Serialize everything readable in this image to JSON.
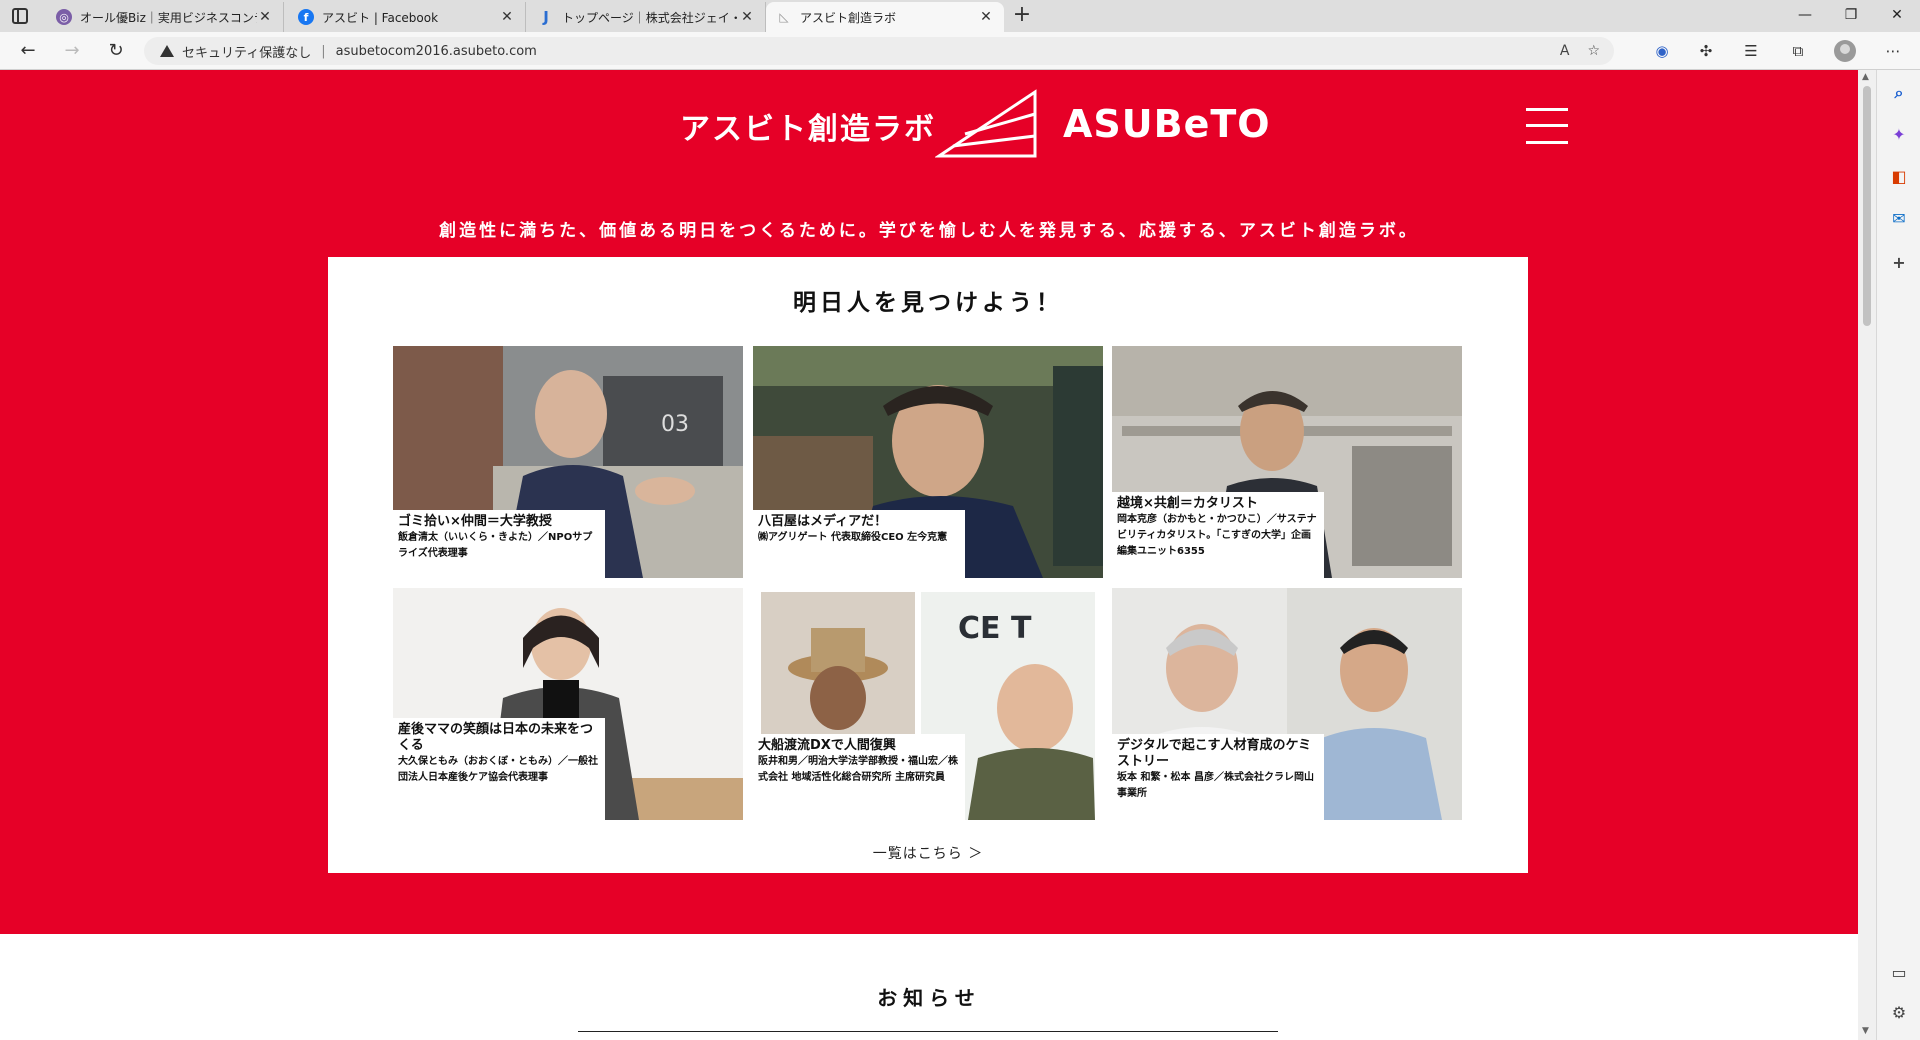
{
  "browser": {
    "tabs": [
      {
        "label": "オール優Biz｜実用ビジネスコンテンツ",
        "favicon": "purple-circle-icon",
        "color": "#7b5ea7"
      },
      {
        "label": "アスビト | Facebook",
        "favicon": "facebook-icon",
        "color": "#1877f2"
      },
      {
        "label": "トップページ｜株式会社ジェイ・キャス",
        "favicon": "j-letter-icon",
        "color": "#2a6dd1"
      },
      {
        "label": "アスビト創造ラボ",
        "favicon": "asubeto-icon",
        "color": "#999999"
      }
    ],
    "security_label": "セキュリティ保護なし",
    "url": "asubetocom2016.asubeto.com"
  },
  "site": {
    "logo_jp": "アスビト創造ラボ",
    "logo_en": "ASUBeTO",
    "tagline": "創造性に満ちた、価値ある明日をつくるために。学びを愉しむ人を発見する、応援する、アスビト創造ラボ。",
    "brand_color": "#e60027"
  },
  "featured": {
    "title": "明日人を見つけよう！",
    "more_link": "一覧はこちら ＞",
    "items": [
      {
        "title": "ゴミ拾い×仲間＝大学教授",
        "sub": "飯倉清太（いいくら・きよた）／NPOサプライズ代表理事"
      },
      {
        "title": "八百屋はメディアだ！",
        "sub": "㈱アグリゲート 代表取締役CEO 左今克憲"
      },
      {
        "title": "越境×共創＝カタリスト",
        "sub": "岡本克彦（おかもと・かつひこ）／サステナビリティカタリスト。「こすぎの大学」企画編集ユニット6355"
      },
      {
        "title": "産後ママの笑顔は日本の未来をつくる",
        "sub": "大久保ともみ（おおくぼ・ともみ）／一般社団法人日本産後ケア協会代表理事"
      },
      {
        "title": "大船渡流DXで人間復興",
        "sub": "阪井和男／明治大学法学部教授・福山宏／株式会社 地域活性化総合研究所 主席研究員"
      },
      {
        "title": "デジタルで起こす人材育成のケミストリー",
        "sub": "坂本 和繁・松本 昌彦／株式会社クラレ岡山事業所"
      }
    ]
  },
  "news": {
    "title": "お知らせ"
  }
}
